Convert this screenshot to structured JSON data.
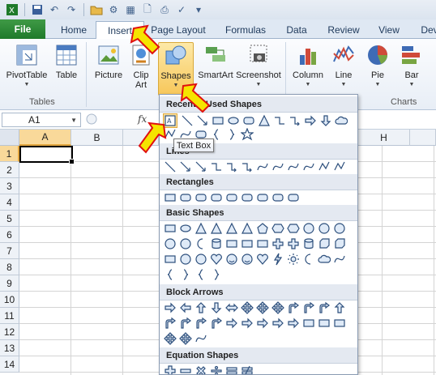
{
  "tabs": {
    "file": "File",
    "home": "Home",
    "insert": "Insert",
    "page_layout": "Page Layout",
    "formulas": "Formulas",
    "data": "Data",
    "review": "Review",
    "view": "View",
    "developer": "Dev"
  },
  "ribbon": {
    "pivottable": "PivotTable",
    "table": "Table",
    "picture": "Picture",
    "clip_art_1": "Clip",
    "clip_art_2": "Art",
    "shapes": "Shapes",
    "smartart": "SmartArt",
    "screenshot": "Screenshot",
    "column": "Column",
    "line": "Line",
    "pie": "Pie",
    "bar": "Bar",
    "group_tables": "Tables",
    "group_charts": "Charts"
  },
  "formula_bar": {
    "name_box": "A1",
    "fx": "fx"
  },
  "grid": {
    "columns": [
      "A",
      "B",
      "H"
    ],
    "rows": [
      "1",
      "2",
      "3",
      "4",
      "5",
      "6",
      "7",
      "8",
      "9",
      "10",
      "11",
      "12",
      "13",
      "14"
    ]
  },
  "shapes_menu": {
    "recent": "Recently Used Shapes",
    "lines": "Lines",
    "rectangles": "Rectangles",
    "basic": "Basic Shapes",
    "block_arrows": "Block Arrows",
    "equation": "Equation Shapes"
  },
  "tooltip": "Text Box",
  "colors": {
    "file_tab": "#2a8a35",
    "highlight": "#f9d99a",
    "arrow_fill": "#f5e400",
    "arrow_stroke": "#e01010"
  }
}
